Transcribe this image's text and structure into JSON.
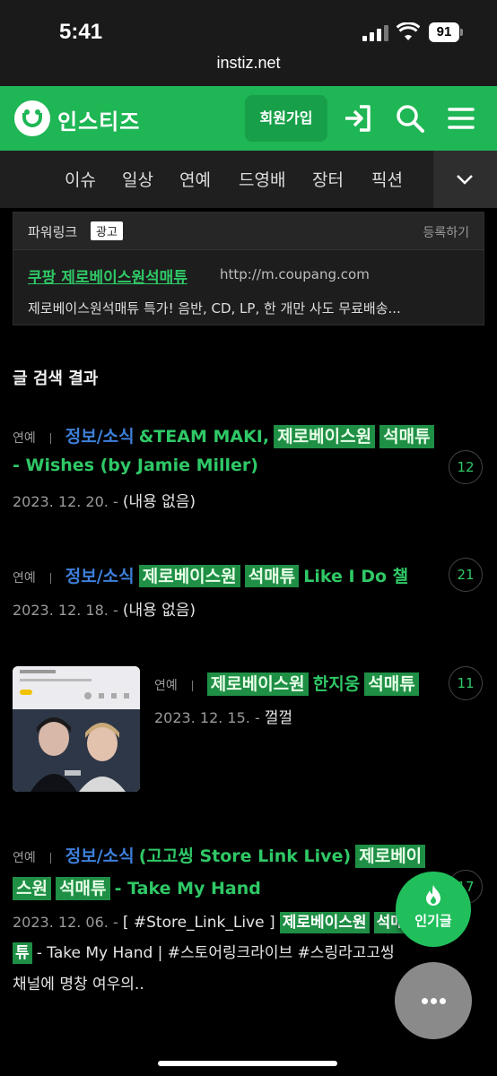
{
  "status_bar": {
    "time": "5:41",
    "battery": "91",
    "url": "instiz.net"
  },
  "header": {
    "logo_text": "인스티즈",
    "join_label": "회원가입"
  },
  "categories": [
    "이슈",
    "일상",
    "연예",
    "드영배",
    "장터",
    "픽션"
  ],
  "ad": {
    "label": "파워링크",
    "badge": "광고",
    "register": "등록하기",
    "title": "쿠팡 제로베이스원석매튜",
    "url": "http://m.coupang.com",
    "description": "제로베이스원석매튜 특가! 음반, CD, LP, 한 개만 사도 무료배송..."
  },
  "section_title": "글 검색 결과",
  "results": [
    {
      "category": "연예",
      "tag": "정보/소식",
      "title_a": "&TEAM MAKI,",
      "hl_a": "제로베이스원",
      "hl_b": "석매튜",
      "title_b": "- Wishes (by Jamie Miller)",
      "count": "12",
      "date": "2023. 12. 20. -",
      "snippet": "(내용 없음)"
    },
    {
      "category": "연예",
      "tag": "정보/소식",
      "hl_a": "제로베이스원",
      "hl_b": "석매튜",
      "title_a": "Like I Do 챌",
      "count": "21",
      "date": "2023. 12. 18. -",
      "snippet": "(내용 없음)"
    },
    {
      "category": "연예",
      "hl_a": "제로베이스원",
      "title_a": "한지웅",
      "hl_b": "석매튜",
      "count": "11",
      "date": "2023. 12. 15. -",
      "snippet": "껄껄"
    },
    {
      "category": "연예",
      "tag": "정보/소식",
      "title_a": "(고고씽 Store Link Live)",
      "hl_a1": "제로베이",
      "hl_a2": "스원",
      "hl_b": "석매튜",
      "title_b": "- Take My Hand",
      "count": "17",
      "date": "2023. 12. 06. -",
      "snippet_a": "[ #Store_Link_Live ]",
      "snippet_hl_a": "제로베이스원",
      "snippet_hl_b": "석매",
      "snippet_hl_c": "튜",
      "snippet_b": "- Take My Hand | #스토어링크라이브 #스링라고고씽",
      "snippet_c": "채널에 명창 여우의.."
    }
  ],
  "fab": {
    "popular_label": "인기글"
  },
  "colors": {
    "brand": "#1fb655",
    "highlight": "#1e8f45",
    "tag_blue": "#3d7fd9"
  }
}
